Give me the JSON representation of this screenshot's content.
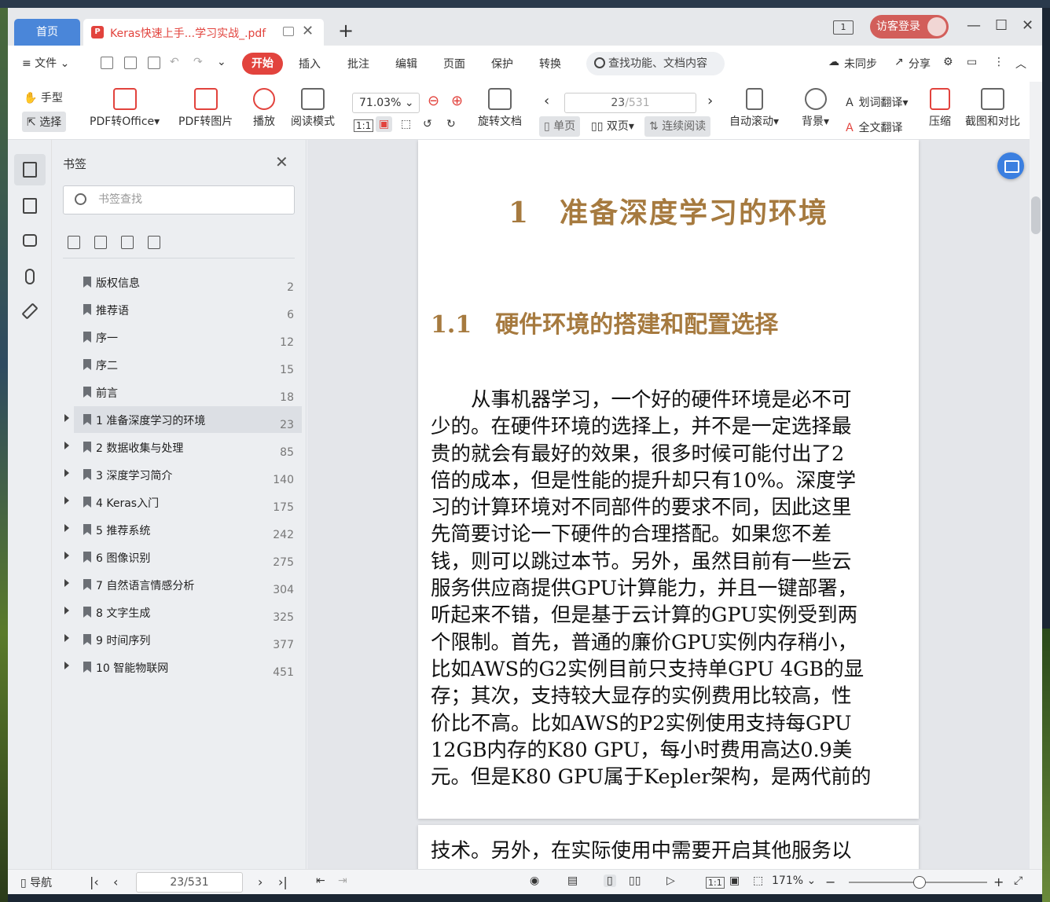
{
  "tabs": {
    "home": "首页",
    "doc_title": "Keras快速上手...学习实战_.pdf",
    "add": "+"
  },
  "window": {
    "page_count_icon": "1",
    "login": "访客登录"
  },
  "menu": {
    "file": "≡ 文件 ⌄",
    "start": "开始",
    "items": [
      "插入",
      "批注",
      "编辑",
      "页面",
      "保护",
      "转换"
    ],
    "search": "查找功能、文档内容",
    "sync": "未同步",
    "share": "分享"
  },
  "toolbar": {
    "hand": "手型",
    "select": "选择",
    "pdf_to_office": "PDF转Office",
    "pdf_to_image": "PDF转图片",
    "play": "播放",
    "read_mode": "阅读模式",
    "zoom": "71.03%",
    "rotate": "旋转文档",
    "page_value": "23",
    "page_total": "/531",
    "single": "单页",
    "double": "双页",
    "continuous": "连续阅读",
    "auto_scroll": "自动滚动",
    "background": "背景",
    "word_translate": "划词翻译",
    "full_translate": "全文翻译",
    "compress": "压缩",
    "screenshot": "截图和对比"
  },
  "bookmarks": {
    "title": "书签",
    "search_placeholder": "书签查找",
    "items": [
      {
        "label": "版权信息",
        "page": "2",
        "expandable": false
      },
      {
        "label": "推荐语",
        "page": "6",
        "expandable": false
      },
      {
        "label": "序一",
        "page": "12",
        "expandable": false
      },
      {
        "label": "序二",
        "page": "15",
        "expandable": false
      },
      {
        "label": "前言",
        "page": "18",
        "expandable": false
      },
      {
        "label": "1 准备深度学习的环境",
        "page": "23",
        "expandable": true,
        "selected": true
      },
      {
        "label": "2 数据收集与处理",
        "page": "85",
        "expandable": true
      },
      {
        "label": "3 深度学习简介",
        "page": "140",
        "expandable": true
      },
      {
        "label": "4 Keras入门",
        "page": "175",
        "expandable": true
      },
      {
        "label": "5 推荐系统",
        "page": "242",
        "expandable": true
      },
      {
        "label": "6 图像识别",
        "page": "275",
        "expandable": true
      },
      {
        "label": "7 自然语言情感分析",
        "page": "304",
        "expandable": true
      },
      {
        "label": "8 文字生成",
        "page": "325",
        "expandable": true
      },
      {
        "label": "9 时间序列",
        "page": "377",
        "expandable": true
      },
      {
        "label": "10 智能物联网",
        "page": "451",
        "expandable": true
      }
    ]
  },
  "document": {
    "chapter_title": "1　准备深度学习的环境",
    "section_title": "1.1　硬件环境的搭建和配置选择",
    "lines": [
      "　　从事机器学习，一个好的硬件环境是必不可",
      "少的。在硬件环境的选择上，并不是一定选择最",
      "贵的就会有最好的效果，很多时候可能付出了2",
      "倍的成本，但是性能的提升却只有10%。深度学",
      "习的计算环境对不同部件的要求不同，因此这里",
      "先简要讨论一下硬件的合理搭配。如果您不差",
      "钱，则可以跳过本节。另外，虽然目前有一些云",
      "服务供应商提供GPU计算能力，并且一键部署，",
      "听起来不错，但是基于云计算的GPU实例受到两",
      "个限制。首先，普通的廉价GPU实例内存稍小，",
      "比如AWS的G2实例目前只支持单GPU 4GB的显",
      "存；其次，支持较大显存的实例费用比较高，性",
      "价比不高。比如AWS的P2实例使用支持每GPU",
      "12GB内存的K80 GPU，每小时费用高达0.9美",
      "元。但是K80 GPU属于Kepler架构，是两代前的"
    ],
    "page2_line": "技术。另外，在实际使用中需要开启其他服务以"
  },
  "statusbar": {
    "nav": "导航",
    "page": "23/531",
    "zoom": "171%"
  },
  "colors": {
    "accent_red": "#e2433d",
    "heading_brown": "#a67a3f",
    "home_tab_blue": "#4a86d9"
  }
}
